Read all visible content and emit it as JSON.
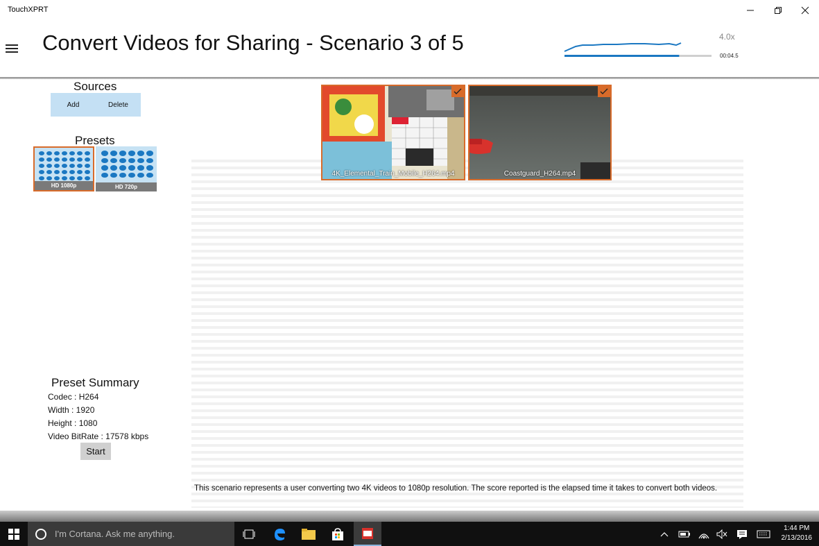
{
  "app": {
    "title": "TouchXPRT"
  },
  "header": {
    "title": "Convert Videos for Sharing - Scenario 3 of 5",
    "multiplier": "4.0x",
    "elapsed": "00:04.5",
    "progress": 0.78,
    "accent_color": "#1b78c2"
  },
  "sources": {
    "heading": "Sources",
    "add_label": "Add",
    "delete_label": "Delete"
  },
  "presets": {
    "heading": "Presets",
    "items": [
      {
        "label": "HD 1080p",
        "selected": true
      },
      {
        "label": "HD 720p",
        "selected": false
      }
    ]
  },
  "summary": {
    "heading": "Preset Summary",
    "codec": "Codec : H264",
    "width": "Width : 1920",
    "height": "Height : 1080",
    "bitrate": "Video BitRate : 17578 kbps",
    "start_label": "Start"
  },
  "videos": [
    {
      "name": "4K_Elemental_Train_Mobile_H264.mp4",
      "checked": true
    },
    {
      "name": "Coastguard_H264.mp4",
      "checked": true
    }
  ],
  "description": "This scenario represents a user converting two 4K videos to 1080p resolution. The score reported is the elapsed time it takes to convert both videos.",
  "selection_color": "#d86b2a",
  "taskbar": {
    "search_placeholder": "I'm Cortana. Ask me anything.",
    "time": "1:44 PM",
    "date": "2/13/2016",
    "icons": [
      "windows-start-icon",
      "task-view-icon",
      "edge-icon",
      "file-explorer-icon",
      "store-icon",
      "touchxprt-icon",
      "chevron-up-icon",
      "battery-icon",
      "wifi-icon",
      "volume-mute-icon",
      "notifications-icon",
      "keyboard-icon"
    ]
  }
}
